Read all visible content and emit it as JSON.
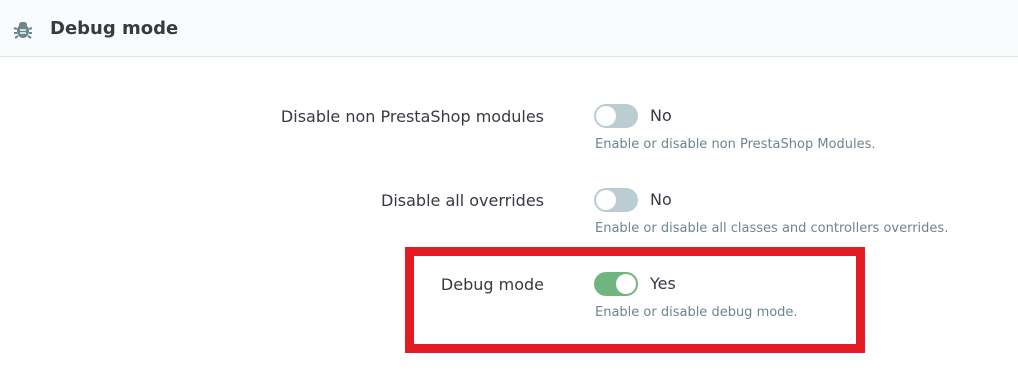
{
  "header": {
    "title": "Debug mode",
    "icon": "bug-icon"
  },
  "fields": [
    {
      "label": "Disable non PrestaShop modules",
      "state": "off",
      "state_label": "No",
      "help": "Enable or disable non PrestaShop Modules."
    },
    {
      "label": "Disable all overrides",
      "state": "off",
      "state_label": "No",
      "help": "Enable or disable all classes and controllers overrides."
    },
    {
      "label": "Debug mode",
      "state": "on",
      "state_label": "Yes",
      "help": "Enable or disable debug mode."
    }
  ],
  "colors": {
    "switch_off": "#bbcdd2",
    "switch_on": "#70b580",
    "highlight": "#e31b23",
    "text": "#363a41",
    "help_text": "#6c868e"
  }
}
